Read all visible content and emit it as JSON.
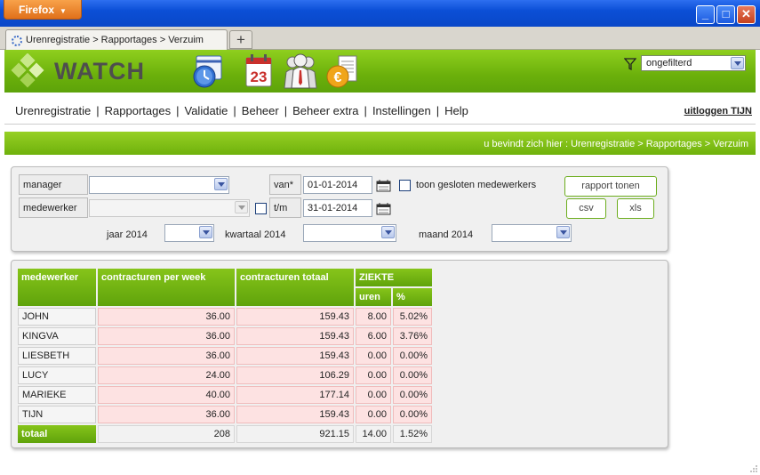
{
  "browser": {
    "app_button": "Firefox",
    "tab_title": "Urenregistratie > Rapportages > Verzuim",
    "new_tab": "+"
  },
  "app": {
    "logo_text": "WATCH",
    "filter_value": "ongefilterd",
    "icons": [
      "clock-calendar-icon",
      "calendar-icon",
      "people-icon",
      "euro-invoice-icon"
    ]
  },
  "menu": {
    "items": [
      "Urenregistratie",
      "Rapportages",
      "Validatie",
      "Beheer",
      "Beheer extra",
      "Instellingen",
      "Help"
    ],
    "separator": "|",
    "logout": "uitloggen TIJN"
  },
  "breadcrumb": "u bevindt zich hier : Urenregistratie > Rapportages > Verzuim",
  "filters": {
    "manager_label": "manager",
    "manager_value": "",
    "employee_label": "medewerker",
    "employee_value": "",
    "from_label": "van*",
    "from_value": "01-01-2014",
    "to_label": "t/m",
    "to_value": "31-01-2014",
    "show_closed_label": "toon gesloten medewerkers",
    "show_closed_checked": false,
    "year_label": "jaar 2014",
    "quarter_label": "kwartaal 2014",
    "month_label": "maand 2014",
    "report_button": "rapport tonen",
    "csv_button": "csv",
    "xls_button": "xls"
  },
  "report": {
    "headers": {
      "employee": "medewerker",
      "contract_week": "contracturen per week",
      "contract_total": "contracturen totaal",
      "sick": "ZIEKTE",
      "hours": "uren",
      "percent": "%"
    },
    "rows": [
      {
        "name": "JOHN",
        "week": "36.00",
        "total": "159.43",
        "hours": "8.00",
        "pct": "5.02%"
      },
      {
        "name": "KINGVA",
        "week": "36.00",
        "total": "159.43",
        "hours": "6.00",
        "pct": "3.76%"
      },
      {
        "name": "LIESBETH",
        "week": "36.00",
        "total": "159.43",
        "hours": "0.00",
        "pct": "0.00%"
      },
      {
        "name": "LUCY",
        "week": "24.00",
        "total": "106.29",
        "hours": "0.00",
        "pct": "0.00%"
      },
      {
        "name": "MARIEKE",
        "week": "40.00",
        "total": "177.14",
        "hours": "0.00",
        "pct": "0.00%"
      },
      {
        "name": "TIJN",
        "week": "36.00",
        "total": "159.43",
        "hours": "0.00",
        "pct": "0.00%"
      }
    ],
    "totals": {
      "label": "totaal",
      "week": "208",
      "total": "921.15",
      "hours": "14.00",
      "pct": "1.52%"
    }
  },
  "colors": {
    "brand_green": "#6bb00b",
    "titlebar_blue": "#0b4fd6",
    "row_pink": "#fde2e2"
  }
}
